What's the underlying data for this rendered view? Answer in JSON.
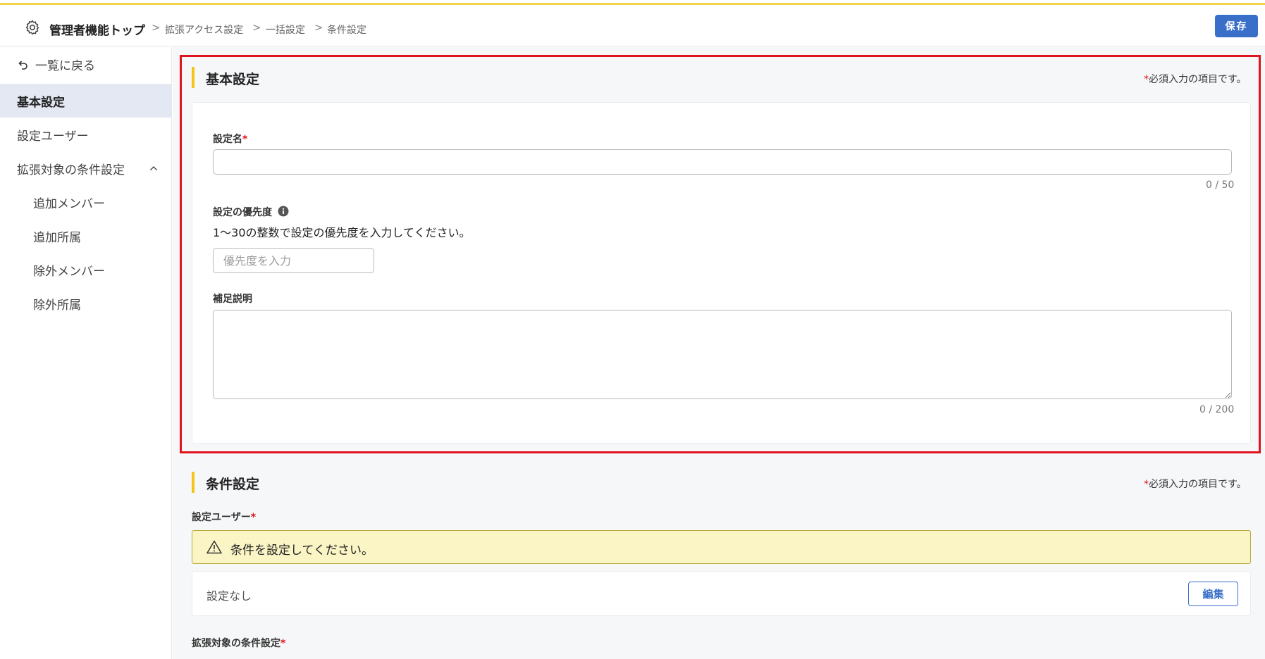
{
  "header": {
    "root": "管理者機能トップ",
    "crumbs": [
      "拡張アクセス設定",
      "一括設定",
      "条件設定"
    ],
    "save_label": "保存"
  },
  "sidebar": {
    "back_label": "一覧に戻る",
    "items": [
      {
        "label": "基本設定",
        "active": true
      },
      {
        "label": "設定ユーザー"
      },
      {
        "label": "拡張対象の条件設定",
        "expanded": true
      },
      {
        "label": "追加メンバー"
      },
      {
        "label": "追加所属"
      },
      {
        "label": "除外メンバー"
      },
      {
        "label": "除外所属"
      }
    ]
  },
  "basic": {
    "title": "基本設定",
    "required_note": "必須入力の項目です。",
    "name_label": "設定名",
    "name_value": "",
    "name_counter": "0 / 50",
    "priority_label": "設定の優先度",
    "priority_help": "1〜30の整数で設定の優先度を入力してください。",
    "priority_placeholder": "優先度を入力",
    "note_label": "補足説明",
    "note_value": "",
    "note_counter": "0 / 200"
  },
  "condition": {
    "title": "条件設定",
    "required_note": "必須入力の項目です。",
    "user_label": "設定ユーザー",
    "warning": "条件を設定してください。",
    "none_text": "設定なし",
    "edit_label": "編集",
    "target_label": "拡張対象の条件設定"
  },
  "colors": {
    "accent_yellow": "#f2c518",
    "primary_blue": "#3a6fc9",
    "highlight_red": "#e0141e",
    "warning_bg": "#fbf5c6"
  }
}
